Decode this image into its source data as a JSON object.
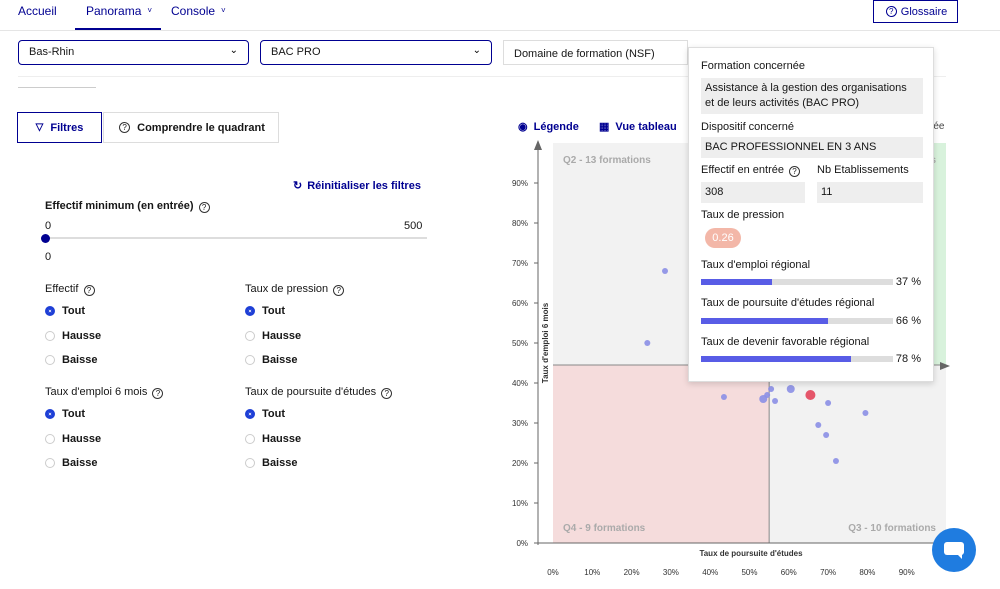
{
  "nav": {
    "items": [
      {
        "label": "Accueil",
        "chevron": ""
      },
      {
        "label": "Panorama",
        "chevron": "˅"
      },
      {
        "label": "Console",
        "chevron": "˅"
      }
    ],
    "glossary": "Glossaire"
  },
  "selects": {
    "region": "Bas-Rhin",
    "diploma": "BAC PRO",
    "domain_placeholder": "Domaine de formation (NSF)"
  },
  "tabs": {
    "filters": "Filtres",
    "quadrant": "Comprendre le quadrant"
  },
  "filters": {
    "reset": "Réinitialiser les filtres",
    "min_title": "Effectif minimum (en entrée)",
    "min_low": "0",
    "min_high": "500",
    "min_value": "0",
    "min_fraction": 0,
    "groups": [
      {
        "title": "Effectif",
        "options": [
          "Tout",
          "Hausse",
          "Baisse"
        ],
        "selected": 0
      },
      {
        "title": "Taux de pression",
        "options": [
          "Tout",
          "Hausse",
          "Baisse"
        ],
        "selected": 0
      },
      {
        "title": "Taux d'emploi 6 mois",
        "options": [
          "Tout",
          "Hausse",
          "Baisse"
        ],
        "selected": 0
      },
      {
        "title": "Taux de poursuite d'études",
        "options": [
          "Tout",
          "Hausse",
          "Baisse"
        ],
        "selected": 0
      }
    ]
  },
  "chart_links": {
    "legend": "Légende",
    "table": "Vue tableau",
    "partial": "rée"
  },
  "chart_data": {
    "type": "scatter",
    "xlabel": "Taux de poursuite d'études",
    "ylabel": "Taux d'emploi 6 mois",
    "xlim": [
      0,
      100
    ],
    "ylim": [
      0,
      100
    ],
    "x_ticks": [
      "0%",
      "10%",
      "20%",
      "30%",
      "40%",
      "50%",
      "60%",
      "70%",
      "80%",
      "90%"
    ],
    "y_ticks": [
      "0%",
      "10%",
      "20%",
      "30%",
      "40%",
      "50%",
      "60%",
      "70%",
      "80%",
      "90%"
    ],
    "x_split": 55,
    "y_split": 44.5,
    "quadrants": {
      "q2": "Q2 - 13 formations",
      "q4": "Q4 - 9 formations",
      "q3": "Q3 - 10 formations",
      "q1_partial": "s"
    },
    "colors": {
      "point": "#8b8fe6",
      "highlight": "#e5566a",
      "q2": "#f2f2f2",
      "q4": "#f5dcdc",
      "q1": "#d8f2dc",
      "q3": "#f2f2f2"
    },
    "points": [
      {
        "x": 28.5,
        "y": 68,
        "size": 3
      },
      {
        "x": 24,
        "y": 50,
        "size": 3
      },
      {
        "x": 43.5,
        "y": 36.5,
        "size": 3
      },
      {
        "x": 53.5,
        "y": 36,
        "size": 4
      },
      {
        "x": 54.5,
        "y": 37,
        "size": 3
      },
      {
        "x": 55.5,
        "y": 38.5,
        "size": 3
      },
      {
        "x": 56.5,
        "y": 35.5,
        "size": 3
      },
      {
        "x": 60.5,
        "y": 38.5,
        "size": 4
      },
      {
        "x": 65.5,
        "y": 37,
        "size": 5,
        "highlight": true
      },
      {
        "x": 70,
        "y": 35,
        "size": 3
      },
      {
        "x": 67.5,
        "y": 29.5,
        "size": 3
      },
      {
        "x": 69.5,
        "y": 27,
        "size": 3
      },
      {
        "x": 72,
        "y": 20.5,
        "size": 3
      },
      {
        "x": 79.5,
        "y": 32.5,
        "size": 3
      }
    ]
  },
  "tooltip": {
    "formation_label": "Formation concernée",
    "formation_value": "Assistance à la gestion des organisations et de leurs activités (BAC PRO)",
    "dispositif_label": "Dispositif concerné",
    "dispositif_value": "BAC PROFESSIONNEL EN 3 ANS",
    "effectif_label": "Effectif en entrée",
    "effectif_value": "308",
    "etab_label": "Nb Etablissements",
    "etab_value": "11",
    "pression_label": "Taux de pression",
    "pression_value": "0.26",
    "emploi_label": "Taux d'emploi régional",
    "emploi_pct": "37 %",
    "emploi_value": 37,
    "poursuite_label": "Taux de poursuite d'études régional",
    "poursuite_pct": "66 %",
    "poursuite_value": 66,
    "devenir_label": "Taux de devenir favorable régional",
    "devenir_pct": "78 %",
    "devenir_value": 78
  }
}
